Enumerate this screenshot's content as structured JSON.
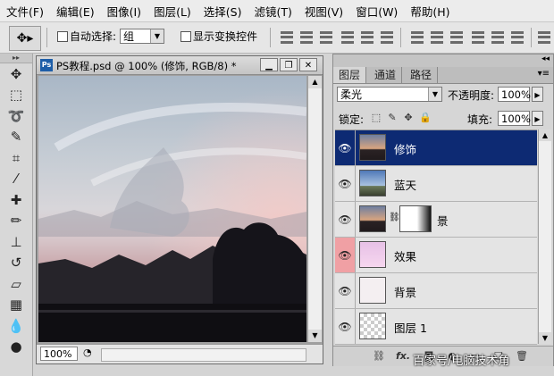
{
  "menu": [
    "文件(F)",
    "编辑(E)",
    "图像(I)",
    "图层(L)",
    "选择(S)",
    "滤镜(T)",
    "视图(V)",
    "窗口(W)",
    "帮助(H)"
  ],
  "options": {
    "tool_icon": "move-tool-icon",
    "auto_select_label": "自动选择:",
    "auto_select_checked": false,
    "auto_select_value": "组",
    "show_transform_label": "显示变换控件",
    "show_transform_checked": false
  },
  "tools": [
    "move",
    "marquee",
    "lasso",
    "quick-select",
    "crop",
    "eyedropper",
    "healing",
    "brush",
    "stamp",
    "history-brush",
    "eraser",
    "gradient",
    "blur",
    "dodge"
  ],
  "document": {
    "title": "PS教程.psd @ 100% (修饰, RGB/8) *",
    "ps_badge": "Ps",
    "zoom": "100%"
  },
  "panel": {
    "tabs": [
      "图层",
      "通道",
      "路径"
    ],
    "active_tab": 0,
    "blend_mode": "柔光",
    "opacity_label": "不透明度:",
    "opacity": "100%",
    "lock_label": "锁定:",
    "fill_label": "填充:",
    "fill": "100%"
  },
  "layers": [
    {
      "name": "修饰",
      "selected": true,
      "visible": true,
      "thumb": "sunset"
    },
    {
      "name": "蓝天",
      "selected": false,
      "visible": true,
      "thumb": "sky"
    },
    {
      "name": "景",
      "selected": false,
      "visible": true,
      "thumb": "sunset",
      "mask": true
    },
    {
      "name": "效果",
      "selected": false,
      "visible": true,
      "thumb": "pink",
      "eye_highlight": true
    },
    {
      "name": "背景",
      "selected": false,
      "visible": true,
      "thumb": "white"
    },
    {
      "name": "图层 1",
      "selected": false,
      "visible": true,
      "thumb": "transparent"
    }
  ],
  "watermark": "百家号/电脑技术角",
  "colors": {
    "selected_layer": "#0d2a73",
    "eye_highlight": "#f0a0a4"
  }
}
